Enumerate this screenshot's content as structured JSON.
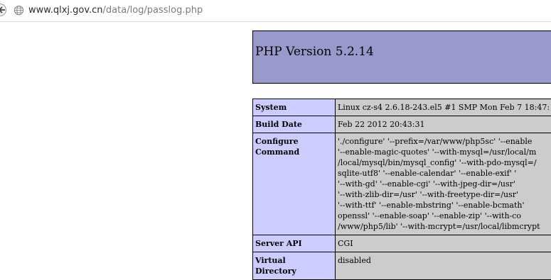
{
  "browser": {
    "url_host": "www.qlxj.gov.cn",
    "url_path": "/data/log/passlog.php"
  },
  "phpinfo": {
    "title": "PHP Version 5.2.14",
    "rows": [
      {
        "key_lines": [
          "System"
        ],
        "value_lines": [
          "Linux cz-s4 2.6.18-243.el5 #1 SMP Mon Feb 7 18:47:"
        ]
      },
      {
        "key_lines": [
          "Build Date"
        ],
        "value_lines": [
          "Feb 22 2012 20:43:31"
        ]
      },
      {
        "key_lines": [
          "Configure",
          "Command"
        ],
        "value_lines": [
          "'./configure' '--prefix=/var/www/php5sc' '--enable",
          "'--enable-magic-quotes' '--with-mysql=/usr/local/m",
          "/local/mysql/bin/mysql_config' '--with-pdo-mysql=/",
          "sqlite-utf8' '--enable-calendar' '--enable-exif' '",
          "'--with-gd' '--enable-cgi' '--with-jpeg-dir=/usr'",
          "'--with-zlib-dir=/usr' '--with-freetype-dir=/usr'",
          "'--with-ttf' '--enable-mbstring' '--enable-bcmath'",
          "openssl' '--enable-soap' '--enable-zip' '--with-co",
          "/www/php5/lib' '--with-mcrypt=/usr/local/libmcrypt"
        ]
      },
      {
        "key_lines": [
          "Server API"
        ],
        "value_lines": [
          "CGI"
        ]
      },
      {
        "key_lines": [
          "Virtual",
          "Directory"
        ],
        "value_lines": [
          "disabled"
        ]
      }
    ]
  },
  "colors": {
    "header_bg": "#9999cc",
    "key_bg": "#ccccff",
    "value_bg": "#cccccc"
  },
  "icons": {
    "back": "back-arrow-icon",
    "site": "globe-icon"
  }
}
